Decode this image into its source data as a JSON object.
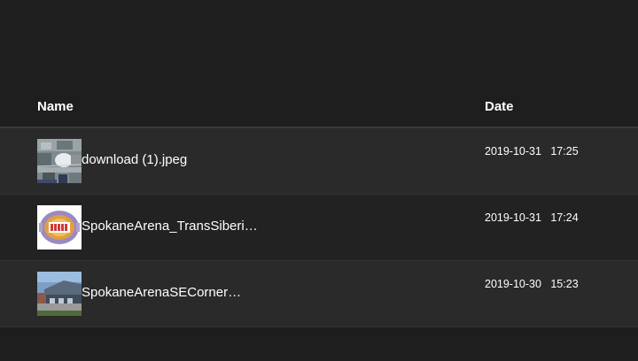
{
  "table": {
    "headers": {
      "name": "Name",
      "date": "Date"
    },
    "rows": [
      {
        "name": "download (1).jpeg",
        "date": "2019-10-31   17:25",
        "thumbnail": "aerial-photo-thumbnail"
      },
      {
        "name": "SpokaneArena_TransSiberi…",
        "date": "2019-10-31   17:24",
        "thumbnail": "seating-chart-thumbnail"
      },
      {
        "name": "SpokaneArenaSECorner…",
        "date": "2019-10-30   15:23",
        "thumbnail": "building-photo-thumbnail"
      }
    ]
  }
}
